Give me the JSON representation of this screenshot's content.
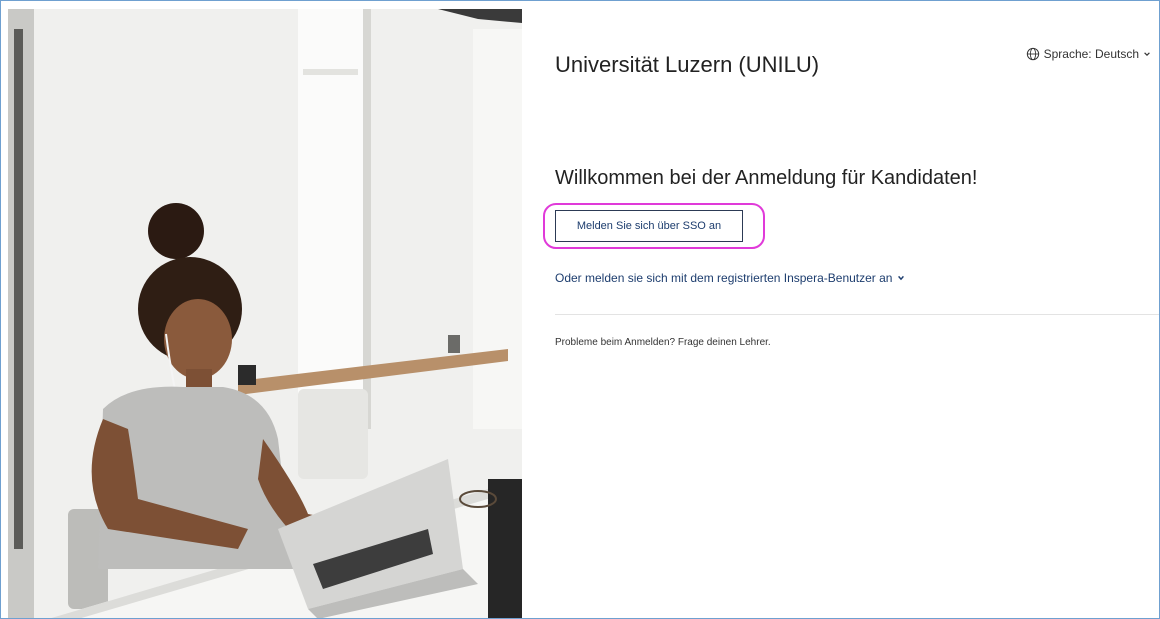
{
  "language": {
    "label": "Sprache: Deutsch"
  },
  "organization": {
    "name": "Universität Luzern (UNILU)"
  },
  "login": {
    "welcome": "Willkommen bei der Anmeldung für Kandidaten!",
    "sso_button_label": "Melden Sie sich über SSO an",
    "alt_login_label": "Oder melden sie sich mit dem registrierten Inspera-Benutzer an",
    "help_text": "Probleme beim Anmelden? Frage deinen Lehrer."
  },
  "colors": {
    "highlight": "#e03ad9",
    "link": "#1d3d6e"
  },
  "icons": {
    "language": "globe-icon",
    "dropdown": "chevron-down-icon"
  }
}
